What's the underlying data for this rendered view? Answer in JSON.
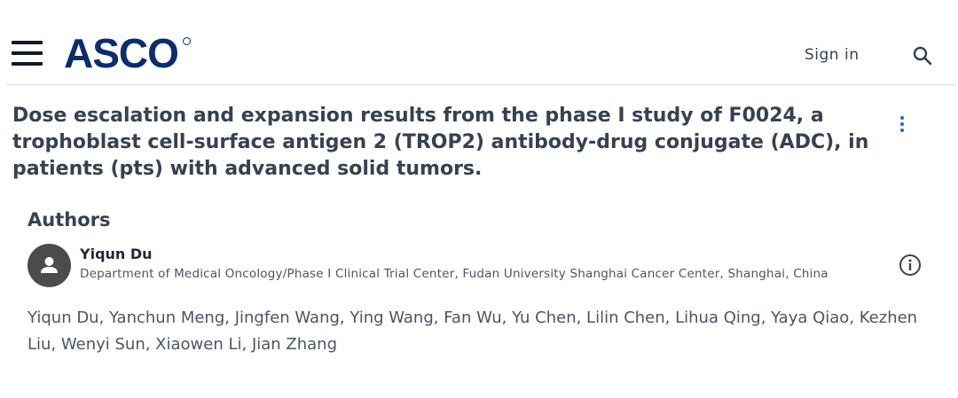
{
  "header": {
    "logo_text": "ASCO",
    "sign_in_label": "Sign in",
    "icons": {
      "menu": "hamburger-menu-icon",
      "search": "search-icon",
      "more": "more-vertical-icon",
      "info": "info-icon",
      "avatar": "person-icon"
    }
  },
  "article": {
    "title": "Dose escalation and expansion results from the phase I study of F0024, a trophoblast cell-surface antigen 2 (TROP2) antibody-drug conjugate (ADC), in patients (pts) with advanced solid tumors."
  },
  "authors": {
    "heading": "Authors",
    "primary": {
      "name": "Yiqun Du",
      "affiliation": "Department of Medical Oncology/Phase I Clinical Trial Center, Fudan University Shanghai Cancer Center, Shanghai, China"
    },
    "list": "Yiqun Du, Yanchun Meng, Jingfen Wang, Ying Wang, Fan Wu, Yu Chen, Lilin Chen, Lihua Qing, Yaya Qiao, Kezhen Liu, Wenyi Sun, Xiaowen Li, Jian Zhang"
  },
  "colors": {
    "brand": "#0b2d6b",
    "accent": "#2563eb",
    "text": "#374151"
  }
}
